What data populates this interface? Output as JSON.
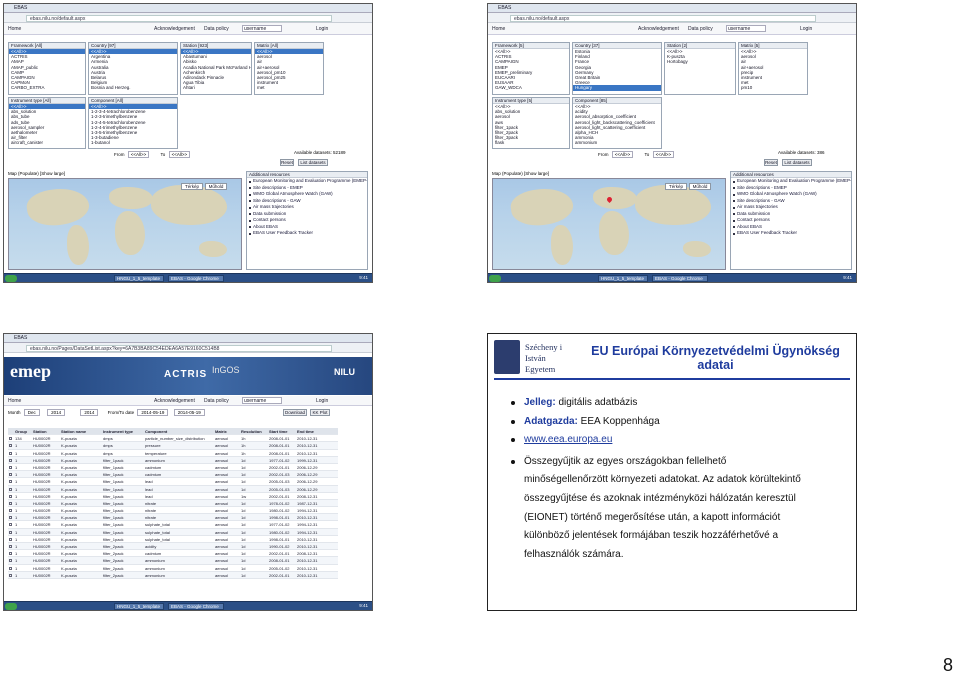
{
  "page_number": "8",
  "browser": {
    "tab_title": "EBAS",
    "url_1": "ebas.nilu.no/default.aspx",
    "url_3": "ebas.nilu.no/Pages/DataSetList.aspx?key=6A7B3BA89C54EDEA6A57E9160C514B8"
  },
  "toolbar": {
    "home": "Home",
    "acknowledgement": "Acknowledgement",
    "data_policy": "Data policy",
    "username": "username",
    "login": "Login"
  },
  "s1": {
    "framework_title": "Framework [All]",
    "framework_items": [
      "<<All>>",
      "ACTRIS",
      "AMAP",
      "AMAP_public",
      "CAMP",
      "CAMPAIGN",
      "CAPMoN",
      "CARBO_EXTRA"
    ],
    "country_title": "Country [97]",
    "country_items": [
      "<<All>>",
      "Argentina",
      "Armenia",
      "Australia",
      "Austria",
      "Belarus",
      "Belgium",
      "Bosnia and Herzeg."
    ],
    "station_title": "Station [923]",
    "station_items": [
      "<<All>>",
      "Abastumani",
      "Abisko",
      "Acadia National Park McFarland Hill",
      "Achenkirch",
      "Adirondack Pinnacle",
      "Agua Tibia",
      "Ahtari"
    ],
    "matrix_title": "Matrix [All]",
    "matrix_items": [
      "<<All>>",
      "aerosol",
      "air",
      "air+aerosol",
      "aerosol_pm10",
      "aerosol_pm25",
      "instrument",
      "met"
    ],
    "instrument_title": "Instrument type [All]",
    "instrument_items": [
      "<<All>>",
      "abs_solution",
      "abs_tube",
      "ads_tube",
      "aerosol_sampler",
      "aethalometer",
      "air_filter",
      "aircraft_canister"
    ],
    "component_title": "Component [All]",
    "component_items": [
      "<<All>>",
      "1-2-3-4-tetrachlorobenzene",
      "1-2-3-trimethylbenzene",
      "1-2-4-5-tetrachlorobenzene",
      "1-2-4-trimethylbenzene",
      "1-3-5-trimethylbenzene",
      "1-3-butadiene",
      "1-butanol"
    ],
    "from_label": "From",
    "to_label": "To",
    "from_value": "<<All>>",
    "to_value": "<<All>>",
    "available": "Available datasets: 52189",
    "reset": "Reset",
    "list": "List datasets"
  },
  "s2": {
    "framework_title": "Framework [5]",
    "framework_items": [
      "<<All>>",
      "ACTRIS",
      "CAMPAIGN",
      "EMEP",
      "EMEP_preliminary",
      "EUCAARI",
      "EUSAAR",
      "GAW_WDCA"
    ],
    "country_title": "Country [37]",
    "country_items": [
      "Estonia",
      "Finland",
      "France",
      "Georgia",
      "Germany",
      "Great Britain",
      "Greece",
      "Hungary"
    ],
    "station_title": "Station [2]",
    "station_items": [
      "<<All>>",
      "K-puszta",
      "Hortobagy"
    ],
    "matrix_title": "Matrix [5]",
    "matrix_items": [
      "<<All>>",
      "aerosol",
      "air",
      "air+aerosol",
      "precip",
      "instrument",
      "met",
      "pm10"
    ],
    "instrument_title": "Instrument type [5]",
    "instrument_items": [
      "<<All>>",
      "abs_solution",
      "aerosol",
      "aws",
      "filter_1pack",
      "filter_2pack",
      "filter_3pack",
      "flask"
    ],
    "component_title": "Component [85]",
    "component_items": [
      "<<All>>",
      "acidity",
      "aerosol_absorption_coefficient",
      "aerosol_light_backscattering_coefficient",
      "aerosol_light_scattering_coefficient",
      "alpha_HCH",
      "ammonia",
      "ammonium"
    ],
    "available": "Available datasets: 386",
    "reset": "Reset",
    "list": "List datasets"
  },
  "map": {
    "title": "Map (Populate) [Show large]",
    "btn_terkep": "Térkép",
    "btn_mukoldas": "Műhold"
  },
  "resources": {
    "title": "Additional resources",
    "items": [
      "European Monitoring and Evaluation Programme (EMEP-CCC)",
      "Site descriptions - EMEP",
      "WMO Global Atmosphere Watch (GAW)",
      "Site descriptions - GAW",
      "Air mass trajectories",
      "Data submission",
      "Contact persons",
      "About EBAS",
      "EBAS User Feedback Tracker"
    ]
  },
  "taskbar": {
    "task_1": "HNGU_1_5_template",
    "task_2": "EBAS - Google Chrome",
    "clock": "9:41"
  },
  "s3": {
    "banner_brand": "emep",
    "actris": "ACTRIS",
    "ingos": "InGOS",
    "nilu": "NILU",
    "month_label": "Month",
    "month_val": "Dec",
    "year_val": "2014",
    "year2_val": "2014",
    "from_label": "From/To date",
    "date_from": "2014-05-19",
    "date_to": "2014-05-19",
    "download": "Download",
    "kmlplot": "KK Plot",
    "headers": [
      "Group",
      "Station",
      "Station name",
      "Instrument type",
      "Component",
      "Matrix",
      "Resolution",
      "Start time",
      "End time"
    ],
    "rows": [
      [
        "134",
        "HU0002R",
        "K-puszta",
        "dmps",
        "particle_number_size_distribution",
        "aerosol",
        "1h",
        "2008-01-01",
        "2010-12-31"
      ],
      [
        "1",
        "HU0002R",
        "K-puszta",
        "dmps",
        "pressure",
        "aerosol",
        "1h",
        "2008-01-01",
        "2010-12-31"
      ],
      [
        "1",
        "HU0002R",
        "K-puszta",
        "dmps",
        "temperature",
        "aerosol",
        "1h",
        "2008-01-01",
        "2010-12-31"
      ],
      [
        "1",
        "HU0002R",
        "K-puszta",
        "filter_1pack",
        "ammonium",
        "aerosol",
        "1d",
        "1977-01-02",
        "1999-12-31"
      ],
      [
        "1",
        "HU0002R",
        "K-puszta",
        "filter_1pack",
        "cadmium",
        "aerosol",
        "1d",
        "2002-01-01",
        "2006-12-29"
      ],
      [
        "1",
        "HU0002R",
        "K-puszta",
        "filter_1pack",
        "cadmium",
        "aerosol",
        "1d",
        "2002-01-03",
        "2006-12-29"
      ],
      [
        "1",
        "HU0002R",
        "K-puszta",
        "filter_1pack",
        "lead",
        "aerosol",
        "1d",
        "2005-01-03",
        "2006-12-29"
      ],
      [
        "1",
        "HU0002R",
        "K-puszta",
        "filter_1pack",
        "lead",
        "aerosol",
        "1d",
        "2005-01-03",
        "2006-12-29"
      ],
      [
        "1",
        "HU0002R",
        "K-puszta",
        "filter_1pack",
        "lead",
        "aerosol",
        "1w",
        "2002-01-01",
        "2008-12-31"
      ],
      [
        "1",
        "HU0002R",
        "K-puszta",
        "filter_1pack",
        "nitrate",
        "aerosol",
        "1d",
        "1978-01-02",
        "1987-12-31"
      ],
      [
        "1",
        "HU0002R",
        "K-puszta",
        "filter_1pack",
        "nitrate",
        "aerosol",
        "1d",
        "1980-01-02",
        "1994-12-31"
      ],
      [
        "1",
        "HU0002R",
        "K-puszta",
        "filter_1pack",
        "nitrate",
        "aerosol",
        "1d",
        "1998-01-01",
        "2010-12-31"
      ],
      [
        "1",
        "HU0002R",
        "K-puszta",
        "filter_1pack",
        "sulphate_total",
        "aerosol",
        "1d",
        "1977-01-02",
        "1994-12-31"
      ],
      [
        "1",
        "HU0002R",
        "K-puszta",
        "filter_1pack",
        "sulphate_total",
        "aerosol",
        "1d",
        "1980-01-02",
        "1994-12-31"
      ],
      [
        "1",
        "HU0002R",
        "K-puszta",
        "filter_1pack",
        "sulphate_total",
        "aerosol",
        "1d",
        "1998-01-01",
        "2010-12-31"
      ],
      [
        "1",
        "HU0002R",
        "K-puszta",
        "filter_2pack",
        "acidity",
        "aerosol",
        "1d",
        "1990-01-02",
        "2010-12-31"
      ],
      [
        "1",
        "HU0002R",
        "K-puszta",
        "filter_2pack",
        "cadmium",
        "aerosol",
        "1d",
        "2002-01-01",
        "2008-12-31"
      ],
      [
        "1",
        "HU0002R",
        "K-puszta",
        "filter_2pack",
        "ammonium",
        "aerosol",
        "1d",
        "2008-01-01",
        "2010-12-31"
      ],
      [
        "1",
        "HU0002R",
        "K-puszta",
        "filter_2pack",
        "ammonium",
        "aerosol",
        "1d",
        "2005-01-02",
        "2010-12-31"
      ],
      [
        "1",
        "HU0002R",
        "K-puszta",
        "filter_2pack",
        "ammonium",
        "aerosol",
        "1d",
        "2002-01-01",
        "2010-12-31"
      ]
    ]
  },
  "s4": {
    "uni_line1": "Szécheny i",
    "uni_line2": "István",
    "uni_line3": "Egyetem",
    "title": "EU Európai Környezetvédelmi Ügynökség adatai",
    "b1_kw": "Jelleg:",
    "b1_txt": " digitális adatbázis",
    "b2_kw": "Adatgazda:",
    "b2_txt": " EEA Koppenhága",
    "b3_link": "www.eea.europa.eu",
    "b4_line1": "Összegyűjtik az egyes országokban fellelhető",
    "b4_line2": "minőségellenőrzött környezeti adatokat. Az adatok körültekintő",
    "b4_line3": "összegyűjtése és azoknak intézményközi hálózatán keresztül",
    "b4_line4": "(EIONET) történő megerősítése után, a kapott információt",
    "b4_line5": "különböző jelentések formájában teszik hozzáférhetővé a",
    "b4_line6": "felhasználók számára."
  },
  "colors": {
    "title_blue": "#1f3c9e",
    "banner": "#1d3f78",
    "selection": "#3a76c4"
  }
}
